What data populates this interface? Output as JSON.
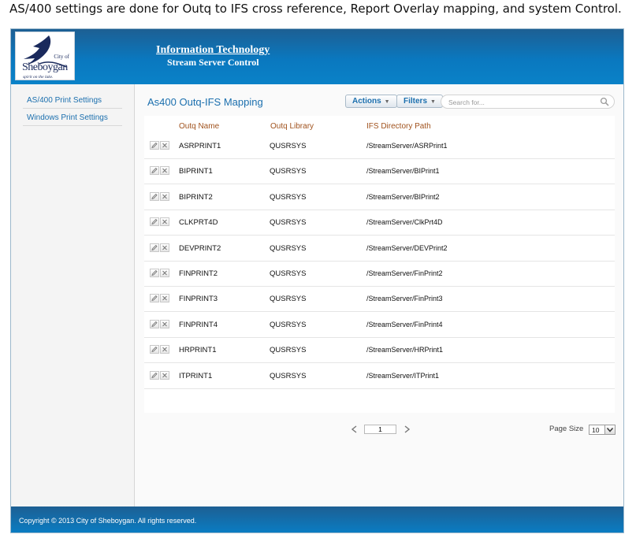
{
  "caption": "AS/400 settings are done for Outq to IFS cross reference, Report Overlay mapping, and system Control.",
  "header": {
    "logo": {
      "city": "City of",
      "name": "Sheboygan",
      "tagline": "spirit on the lake."
    },
    "title": "Information Technology",
    "subtitle": "Stream Server Control"
  },
  "sidebar": {
    "items": [
      {
        "label": "AS/400 Print Settings"
      },
      {
        "label": "Windows Print Settings"
      }
    ]
  },
  "main": {
    "title": "As400 Outq-IFS Mapping",
    "actions_label": "Actions",
    "filters_label": "Filters",
    "search_placeholder": "Search for..."
  },
  "table": {
    "columns": [
      "Outq Name",
      "Outq Library",
      "IFS Directory Path"
    ],
    "rows": [
      {
        "name": "ASRPRINT1",
        "library": "QUSRSYS",
        "path": "/StreamServer/ASRPrint1"
      },
      {
        "name": "BIPRINT1",
        "library": "QUSRSYS",
        "path": "/StreamServer/BIPrint1"
      },
      {
        "name": "BIPRINT2",
        "library": "QUSRSYS",
        "path": "/StreamServer/BIPrint2"
      },
      {
        "name": "CLKPRT4D",
        "library": "QUSRSYS",
        "path": "/StreamServer/ClkPrt4D"
      },
      {
        "name": "DEVPRINT2",
        "library": "QUSRSYS",
        "path": "/StreamServer/DEVPrint2"
      },
      {
        "name": "FINPRINT2",
        "library": "QUSRSYS",
        "path": "/StreamServer/FinPrint2"
      },
      {
        "name": "FINPRINT3",
        "library": "QUSRSYS",
        "path": "/StreamServer/FinPrint3"
      },
      {
        "name": "FINPRINT4",
        "library": "QUSRSYS",
        "path": "/StreamServer/FinPrint4"
      },
      {
        "name": "HRPRINT1",
        "library": "QUSRSYS",
        "path": "/StreamServer/HRPrint1"
      },
      {
        "name": "ITPRINT1",
        "library": "QUSRSYS",
        "path": "/StreamServer/ITPrint1"
      }
    ]
  },
  "pager": {
    "page": "1",
    "page_size_label": "Page Size",
    "page_size": "10"
  },
  "footer": {
    "text": "Copyright © 2013 City of Sheboygan. All rights reserved."
  },
  "colors": {
    "header_blue": "#0a78bf",
    "link_blue": "#1b6fae",
    "column_header": "#a0521d"
  },
  "icons": {
    "edit": "pencil-icon",
    "delete": "close-icon",
    "search": "search-icon",
    "prev": "chevron-left-icon",
    "next": "chevron-right-icon",
    "dropdown": "chevron-down-icon"
  }
}
